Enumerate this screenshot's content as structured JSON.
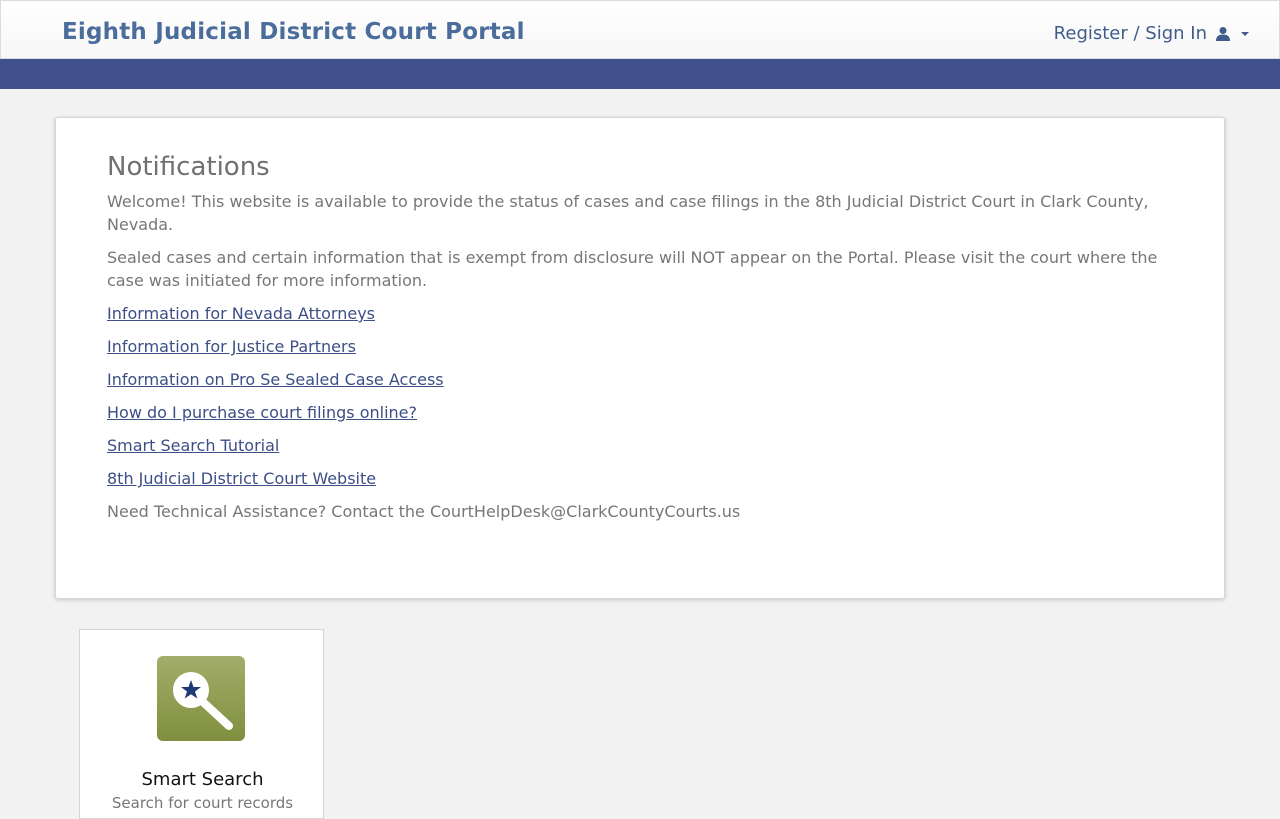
{
  "header": {
    "title": "Eighth Judicial District Court Portal",
    "signin_label": "Register / Sign In",
    "user_icon": "user-icon",
    "caret_icon": "caret-down-icon"
  },
  "colors": {
    "title": "#4a6d9c",
    "navbar": "#40508c",
    "link": "#3c4f86",
    "tile_icon": "#8a9a4c"
  },
  "notifications": {
    "title": "Notifications",
    "welcome": "Welcome! This website is available to provide the status of cases and case filings in the 8th Judicial District Court in Clark County, Nevada.",
    "sealed": "Sealed cases and certain information that is exempt from disclosure will NOT appear on the Portal. Please visit the court where the case was initiated for more information.",
    "links": [
      "Information for Nevada Attorneys",
      "Information for Justice Partners",
      "Information on Pro Se Sealed Case Access",
      "How do I purchase court filings online?",
      "Smart Search Tutorial",
      "8th Judicial District Court Website"
    ],
    "help": "Need Technical Assistance? Contact the CourtHelpDesk@ClarkCountyCourts.us"
  },
  "tiles": [
    {
      "title": "Smart Search",
      "subtitle": "Search for court records",
      "icon": "smart-search-icon"
    }
  ]
}
